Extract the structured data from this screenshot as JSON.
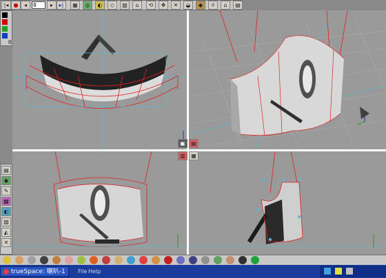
{
  "app": {
    "taskbar_title": "trueSpace: 喇叭-1"
  },
  "taskbar_menu": {
    "file": "File",
    "help": "Help"
  },
  "toolbar": {
    "frame_value": "0"
  },
  "colors": {
    "wire": "#e02020",
    "selection": "#60c0d8",
    "viewport_bg": "#9a9a9a",
    "taskbar": "#1a3c9c"
  },
  "viewports": [
    "front-left",
    "perspective",
    "front",
    "side"
  ],
  "icons": [
    "record-icon",
    "rewind-icon",
    "play-icon",
    "forward-icon",
    "end-icon",
    "grid-icon",
    "move-icon",
    "rotate-icon",
    "scale-icon",
    "camera-icon",
    "sphere-icon",
    "home-icon"
  ]
}
